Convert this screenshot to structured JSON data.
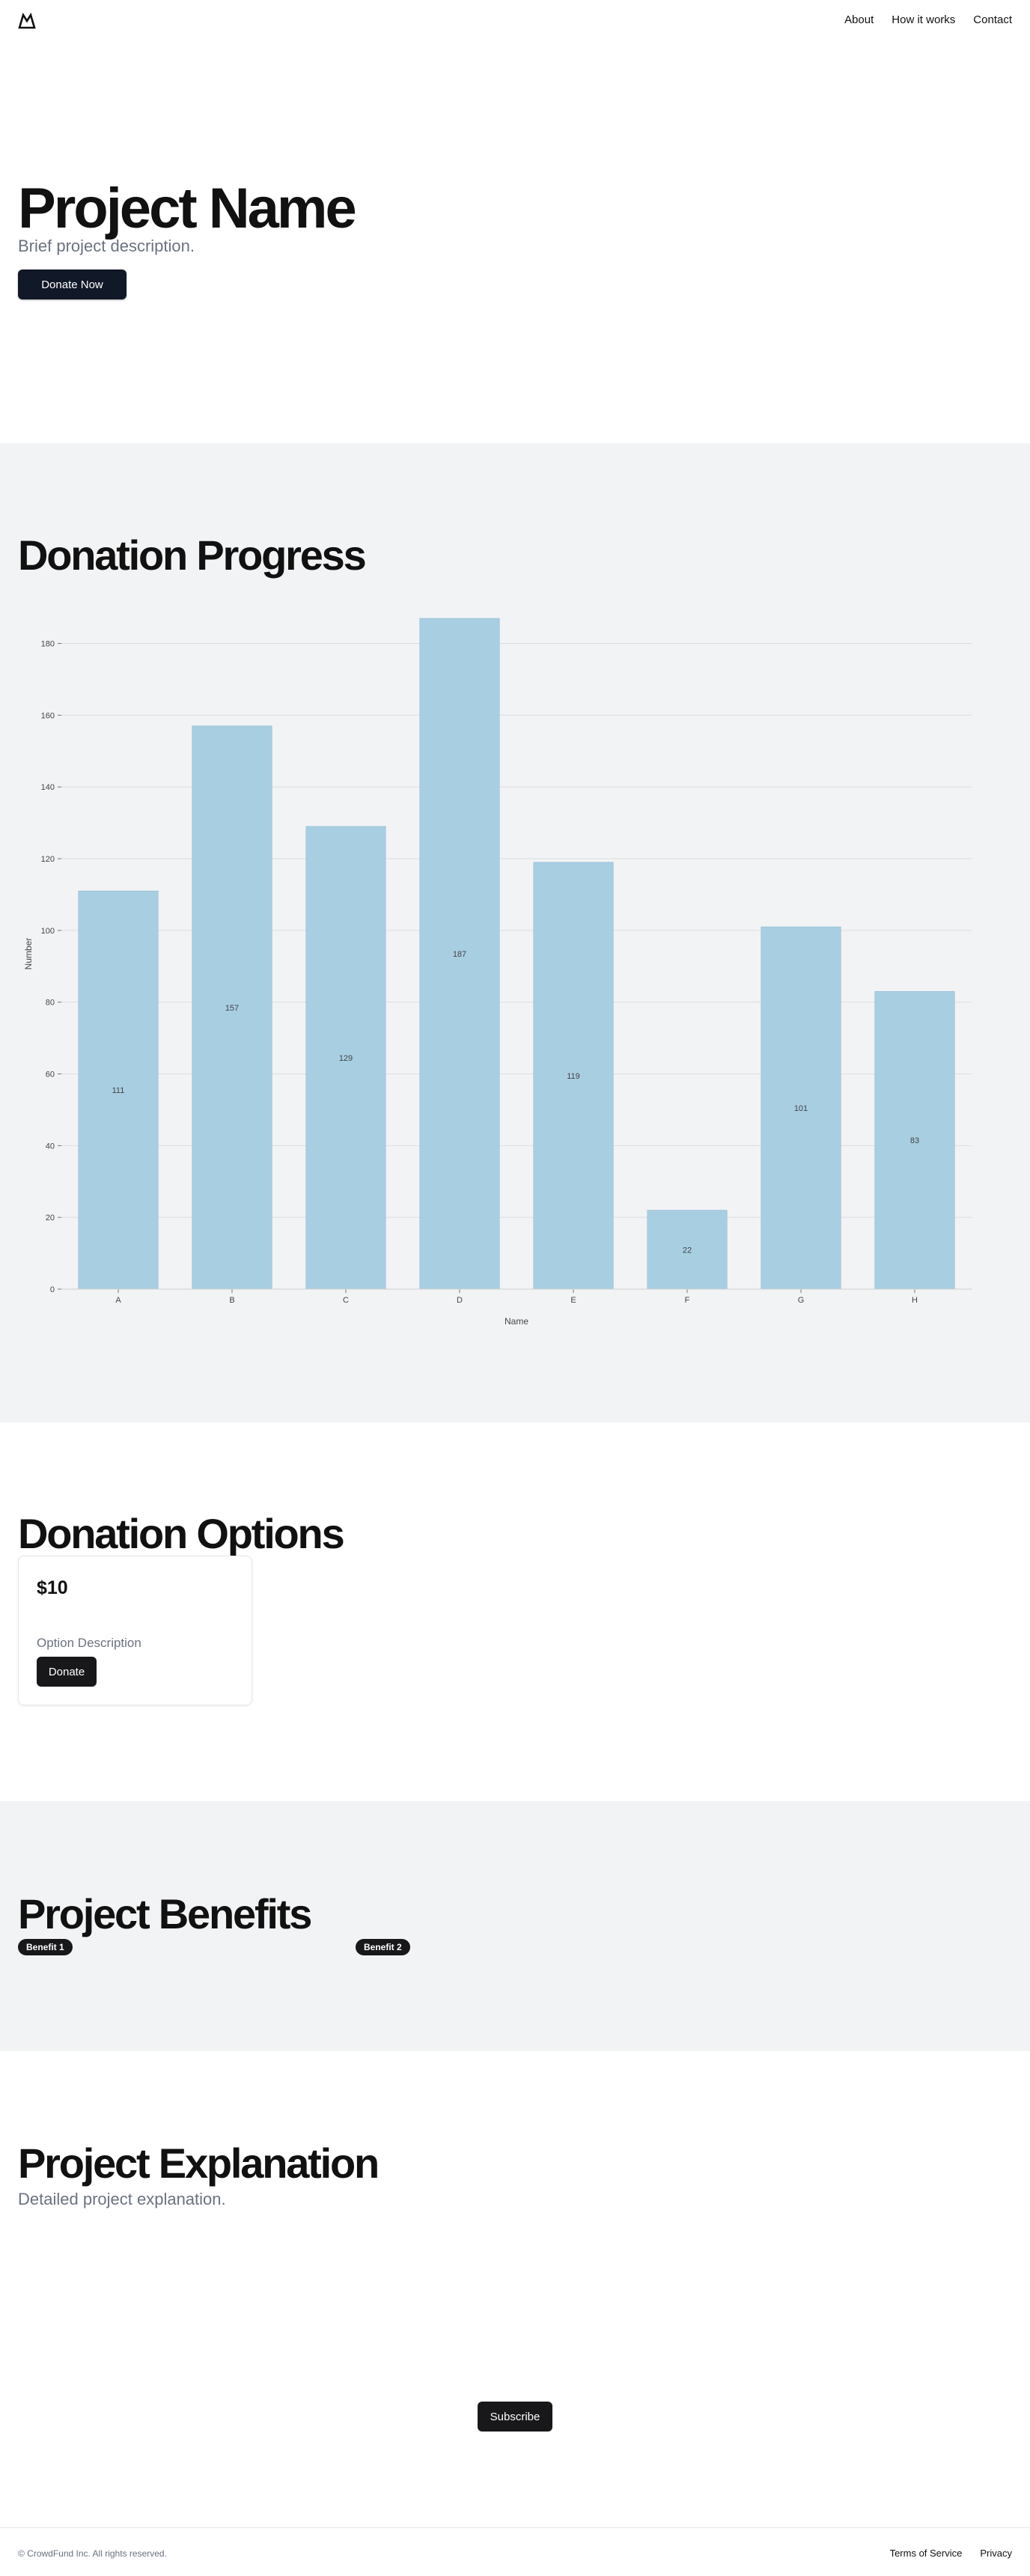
{
  "nav": {
    "about": "About",
    "how_it_works": "How it works",
    "contact": "Contact"
  },
  "hero": {
    "title": "Project Name",
    "subtitle": "Brief project description.",
    "cta": "Donate Now"
  },
  "progress": {
    "title": "Donation Progress"
  },
  "chart_data": {
    "type": "bar",
    "categories": [
      "A",
      "B",
      "C",
      "D",
      "E",
      "F",
      "G",
      "H"
    ],
    "values": [
      111,
      157,
      129,
      187,
      119,
      22,
      101,
      83
    ],
    "xlabel": "Name",
    "ylabel": "Number",
    "ylim": [
      0,
      187
    ],
    "yticks": [
      0,
      20,
      40,
      60,
      80,
      100,
      120,
      140,
      160,
      180
    ],
    "grid": true,
    "bar_color": "#a8cee2"
  },
  "options": {
    "title": "Donation Options",
    "items": [
      {
        "amount": "$10",
        "description": "Option Description",
        "button": "Donate"
      }
    ]
  },
  "benefits": {
    "title": "Project Benefits",
    "items": [
      "Benefit 1",
      "Benefit 2"
    ]
  },
  "explanation": {
    "title": "Project Explanation",
    "subtitle": "Detailed project explanation.",
    "subscribe": "Subscribe"
  },
  "footer": {
    "copyright": "© CrowdFund Inc. All rights reserved.",
    "terms": "Terms of Service",
    "privacy": "Privacy"
  },
  "colors": {
    "primary_button": "#111827",
    "dark_button": "#18181b",
    "section_gray": "#f2f3f5",
    "muted_text": "#6b7280"
  }
}
